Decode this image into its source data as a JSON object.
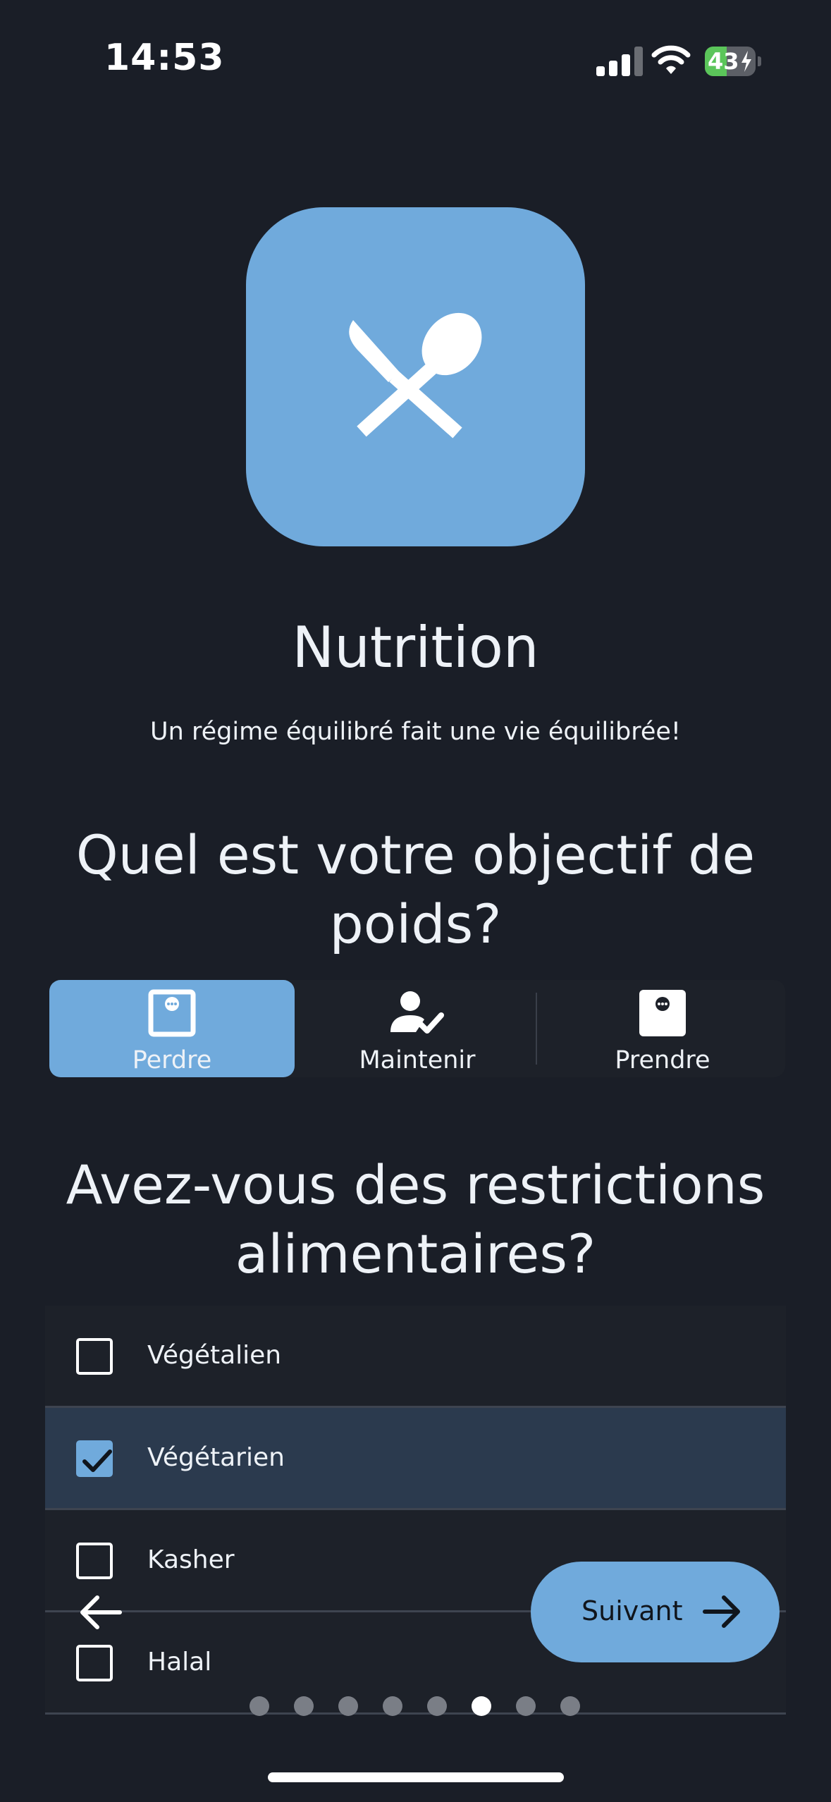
{
  "status_bar": {
    "time": "14:53",
    "battery": "43",
    "battery_level": 0.43
  },
  "header": {
    "icon": "fork-spoon-icon",
    "title": "Nutrition",
    "subtitle": "Un régime équilibré fait une vie équilibrée!"
  },
  "weight_goal": {
    "question": "Quel est votre objectif de poids?",
    "options": [
      {
        "label": "Perdre",
        "icon": "scale-icon",
        "selected": true
      },
      {
        "label": "Maintenir",
        "icon": "person-check-icon",
        "selected": false
      },
      {
        "label": "Prendre",
        "icon": "scale-filled-icon",
        "selected": false
      }
    ]
  },
  "restrictions": {
    "question": "Avez-vous des restrictions alimentaires?",
    "items": [
      {
        "label": "Végétalien",
        "checked": false
      },
      {
        "label": "Végétarien",
        "checked": true
      },
      {
        "label": "Kasher",
        "checked": false
      },
      {
        "label": "Halal",
        "checked": false
      }
    ]
  },
  "navigation": {
    "back_icon": "arrow-left-icon",
    "next_label": "Suivant",
    "next_icon": "arrow-right-icon",
    "total_steps": 8,
    "current_step": 6
  },
  "colors": {
    "accent": "#70aadc",
    "background": "#1a1e27",
    "selected_row": "#2b3a4e"
  }
}
